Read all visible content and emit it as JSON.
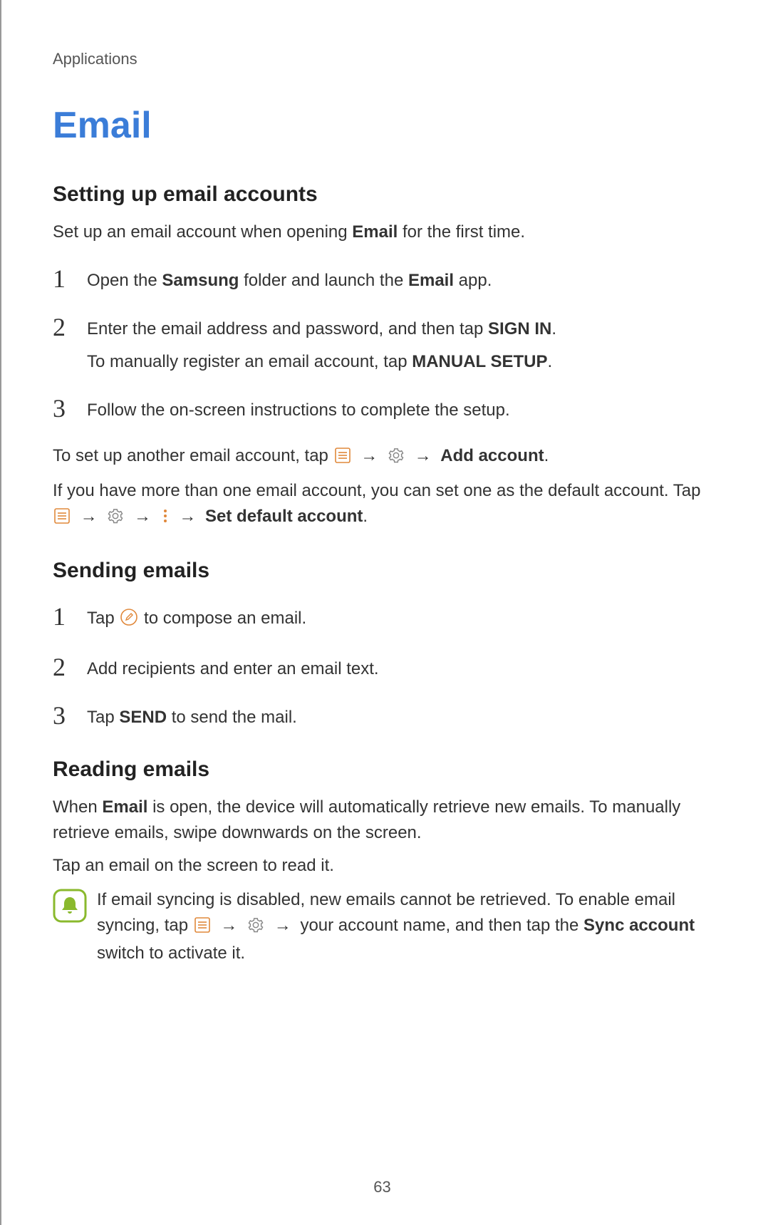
{
  "header": "Applications",
  "title": "Email",
  "section1": {
    "heading": "Setting up email accounts",
    "intro_pre": "Set up an email account when opening ",
    "intro_bold": "Email",
    "intro_post": " for the first time.",
    "step1_pre": "Open the ",
    "step1_b1": "Samsung",
    "step1_mid": " folder and launch the ",
    "step1_b2": "Email",
    "step1_post": " app.",
    "step2_pre": "Enter the email address and password, and then tap ",
    "step2_b": "SIGN IN",
    "step2_post": ".",
    "step2_sub_pre": "To manually register an email account, tap ",
    "step2_sub_b": "MANUAL SETUP",
    "step2_sub_post": ".",
    "step3": "Follow the on-screen instructions to complete the setup.",
    "another_pre": "To set up another email account, tap ",
    "another_b": "Add account",
    "another_post": ".",
    "default_pre": "If you have more than one email account, you can set one as the default account. Tap ",
    "default_b": "Set default account",
    "default_post": "."
  },
  "section2": {
    "heading": "Sending emails",
    "step1_pre": "Tap ",
    "step1_post": " to compose an email.",
    "step2": "Add recipients and enter an email text.",
    "step3_pre": "Tap ",
    "step3_b": "SEND",
    "step3_post": " to send the mail."
  },
  "section3": {
    "heading": "Reading emails",
    "p1_pre": "When ",
    "p1_b": "Email",
    "p1_post": " is open, the device will automatically retrieve new emails. To manually retrieve emails, swipe downwards on the screen.",
    "p2": "Tap an email on the screen to read it.",
    "note_pre": "If email syncing is disabled, new emails cannot be retrieved. To enable email syncing, tap ",
    "note_mid": " your account name, and then tap the ",
    "note_b": "Sync account",
    "note_post": " switch to activate it."
  },
  "arrow": "→",
  "page_number": "63"
}
